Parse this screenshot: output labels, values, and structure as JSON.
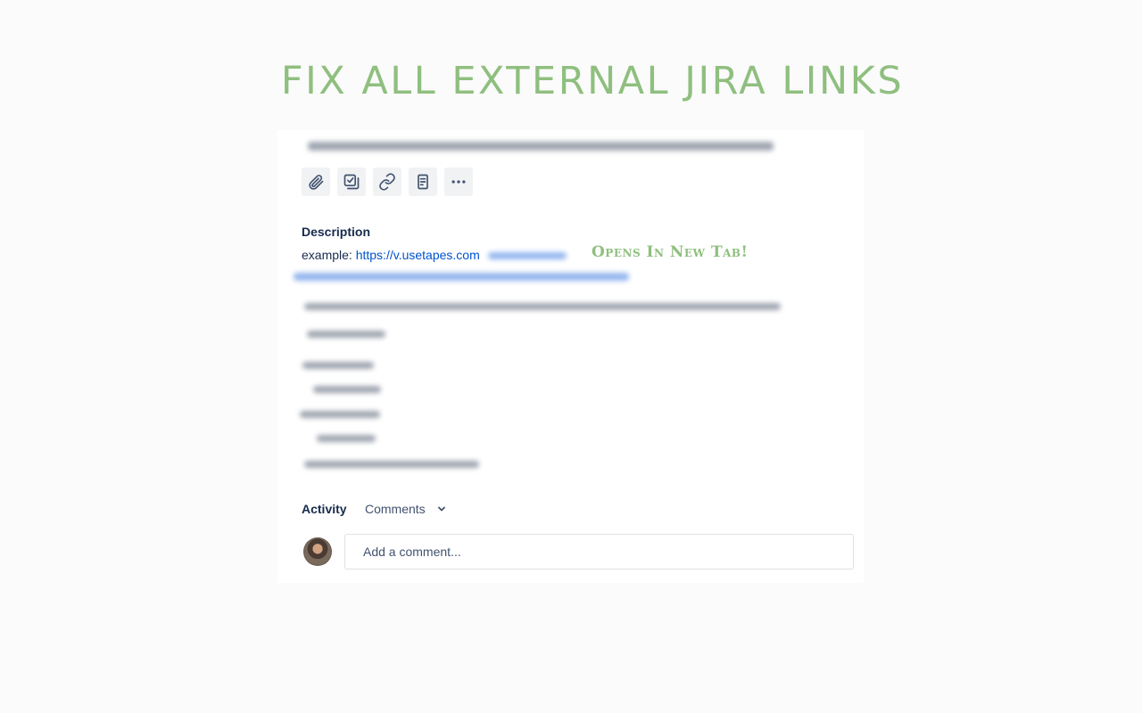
{
  "headline": "FIX ALL EXTERNAL JIRA LINKS",
  "toolbar": {
    "buttons": [
      {
        "icon": "paperclip-icon",
        "label": "Attach"
      },
      {
        "icon": "checklist-icon",
        "label": "Add a child issue"
      },
      {
        "icon": "link-icon",
        "label": "Link issue"
      },
      {
        "icon": "page-icon",
        "label": "Add page"
      },
      {
        "icon": "more-icon",
        "label": "More"
      }
    ]
  },
  "description": {
    "label": "Description",
    "prefix": "example: ",
    "link_text": "https://v.usetapes.com"
  },
  "annotation": "Opens In New Tab!",
  "activity": {
    "label": "Activity",
    "filter": "Comments"
  },
  "comment": {
    "placeholder": "Add a comment..."
  },
  "colors": {
    "accent_green": "#8fbf7f",
    "link_blue": "#0052cc",
    "text_dark": "#172b4d"
  }
}
